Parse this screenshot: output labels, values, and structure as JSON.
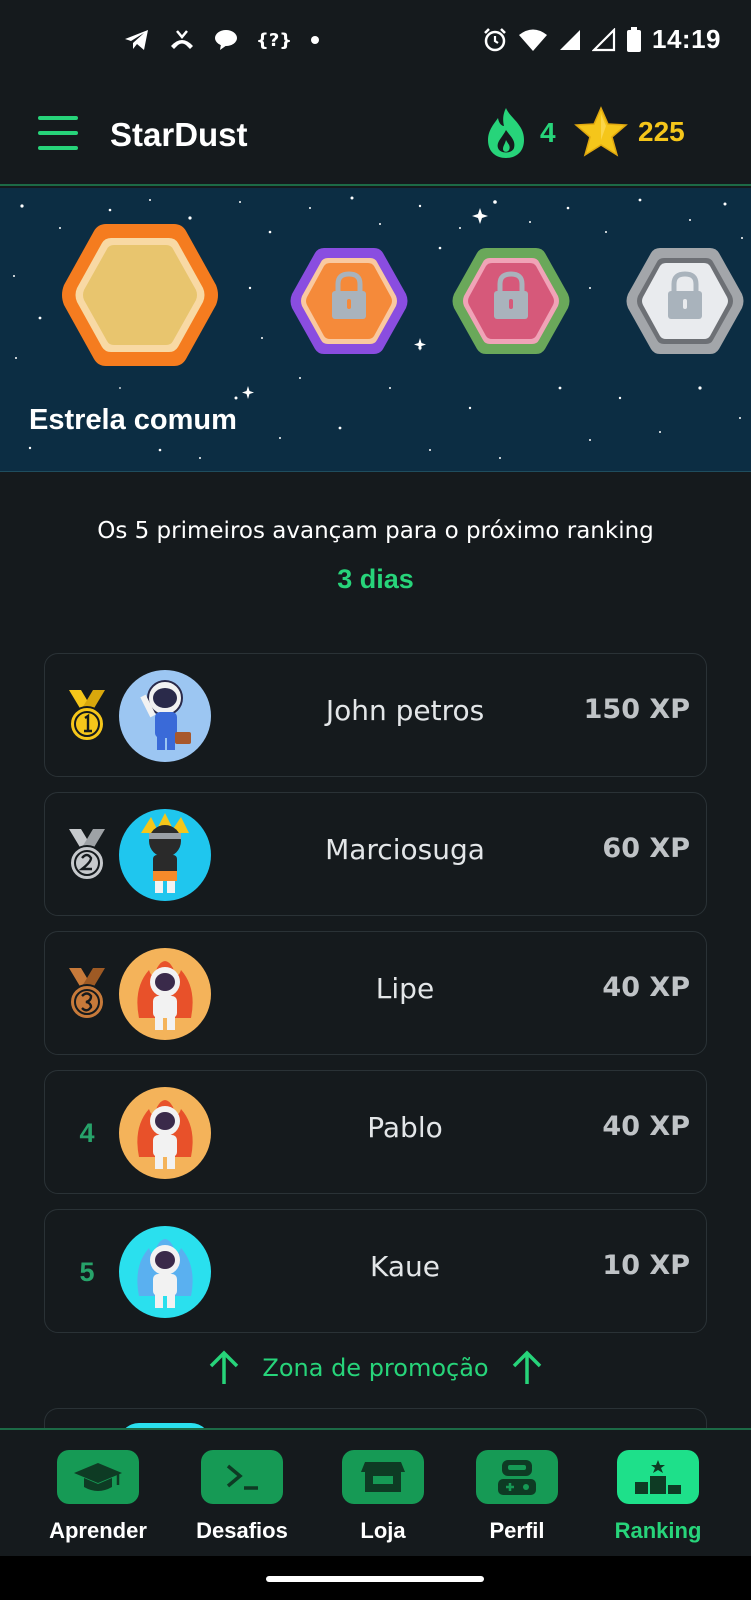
{
  "status_bar": {
    "time": "14:19",
    "left_icons": [
      "telegram-icon",
      "missed-call-icon",
      "chat-bubble-icon",
      "code-icon",
      "dot-icon"
    ],
    "code_icon_text": "{?}",
    "right_icons": [
      "alarm-icon",
      "wifi-icon",
      "signal-icon",
      "signal-empty-icon",
      "battery-icon"
    ]
  },
  "app_bar": {
    "title": "StarDust",
    "streak_count": "4",
    "star_count": "225",
    "colors": {
      "accent": "#27d47a",
      "star": "#f5c61a"
    }
  },
  "league": {
    "current_name": "Estrela comum",
    "badges": [
      {
        "name": "estrela-comum",
        "locked": false,
        "outer": "#f57c1f",
        "inner": "#e8c56e"
      },
      {
        "name": "league-2",
        "locked": true,
        "outer": "#8a4de0",
        "inner": "#f58a3a"
      },
      {
        "name": "league-3",
        "locked": true,
        "outer": "#6aa85a",
        "inner": "#d6597a"
      },
      {
        "name": "league-4",
        "locked": true,
        "outer": "#a3a6aa",
        "inner": "#e9ebee"
      }
    ]
  },
  "info": {
    "text": "Os 5 primeiros avançam para o próximo ranking",
    "days": "3 dias"
  },
  "ranking": [
    {
      "position": "1",
      "medal": "gold-medal-icon",
      "name": "John petros",
      "xp": "150 XP",
      "avatar_bg": "#9cc6f2"
    },
    {
      "position": "2",
      "medal": "silver-medal-icon",
      "name": "Marciosuga",
      "xp": "60 XP",
      "avatar_bg": "#1fc6ee"
    },
    {
      "position": "3",
      "medal": "bronze-medal-icon",
      "name": "Lipe",
      "xp": "40 XP",
      "avatar_bg": "#f4b35a"
    },
    {
      "position": "4",
      "medal": "",
      "name": "Pablo",
      "xp": "40 XP",
      "avatar_bg": "#f4b35a"
    },
    {
      "position": "5",
      "medal": "",
      "name": "Kaue",
      "xp": "10 XP",
      "avatar_bg": "#2ae0ee"
    }
  ],
  "promotion_zone": "Zona de promoção",
  "bottom_nav": [
    {
      "label": "Aprender",
      "icon": "graduation-cap-icon",
      "active": false
    },
    {
      "label": "Desafios",
      "icon": "terminal-icon",
      "active": false
    },
    {
      "label": "Loja",
      "icon": "store-icon",
      "active": false
    },
    {
      "label": "Perfil",
      "icon": "robot-profile-icon",
      "active": false
    },
    {
      "label": "Ranking",
      "icon": "podium-icon",
      "active": true
    }
  ]
}
